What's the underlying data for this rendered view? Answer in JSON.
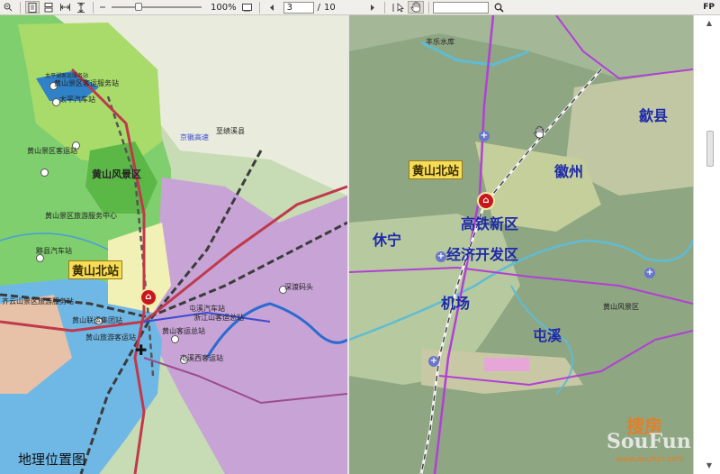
{
  "toolbar": {
    "zoom_value": "100%",
    "page_current": "3",
    "page_separator": "/",
    "page_total": "10",
    "search_value": "",
    "fp_label": "FP",
    "zoom_fraction": 0.28
  },
  "left_map": {
    "title": "地理位置图",
    "callout": "黄山北站",
    "labels": [
      "太平湖客运服务站",
      "太平汽车站",
      "黄山景区客运服务站",
      "黄山景区客运站",
      "黄山风景区",
      "黄山景区旅游服务中心",
      "黟县汽车站",
      "齐云山景区旅游服务站",
      "黄山联运集团站",
      "黄山旅游客运站",
      "黄山客运总站",
      "屯溪西客运站",
      "浙江山客运总站",
      "屯溪汽车站",
      "京徽高速",
      "至绩溪县",
      "深渡码头"
    ]
  },
  "right_map": {
    "callout": "黄山北站",
    "places": [
      "歙县",
      "徽州",
      "高铁新区",
      "休宁",
      "经济开发区",
      "机场",
      "屯溪"
    ],
    "small_labels": [
      "丰乐水库",
      "黄山风景区"
    ]
  },
  "watermark": {
    "brand_cn": "搜房",
    "brand_en": "SouFun",
    "url": "www.soufun.com"
  },
  "colors": {
    "left_green": "#7fcf6e",
    "left_purple": "#c7a3d6",
    "left_blue": "#6fb8e6",
    "railway": "#3b3b3b",
    "highway": "#c0394b",
    "station_red": "#c8161d",
    "label_blue": "#1f2aa8",
    "callout_yellow": "#f6dc57"
  }
}
